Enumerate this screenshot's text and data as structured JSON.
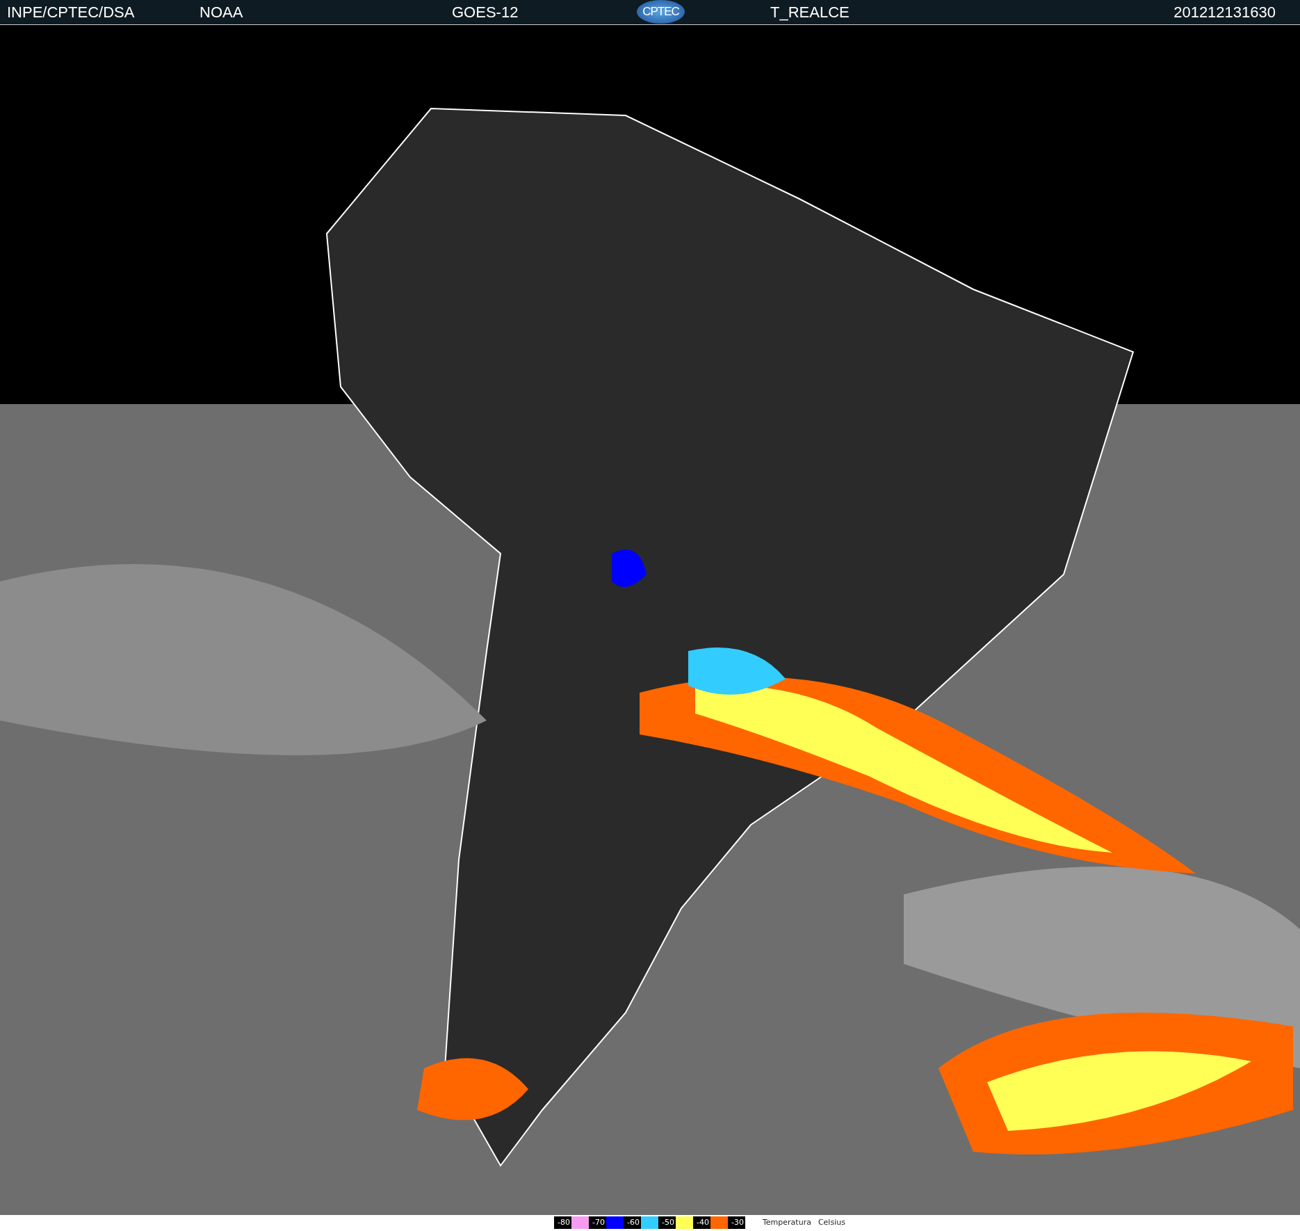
{
  "header": {
    "items": [
      "INPE/CPTEC/DSA",
      "NOAA",
      "GOES-12"
    ],
    "logo_text": "CPTEC",
    "product": "T_REALCE",
    "timestamp": "201212131630"
  },
  "legend": {
    "items": [
      {
        "label": "-80",
        "color": "#f59cf0"
      },
      {
        "label": "-70",
        "color": "#0000ff"
      },
      {
        "label": "-60",
        "color": "#33ccff"
      },
      {
        "label": "-50",
        "color": "#ffff55"
      },
      {
        "label": "-40",
        "color": "#ff6600"
      },
      {
        "label": "-30"
      }
    ],
    "title": "Temperatura",
    "unit": "Celsius"
  }
}
